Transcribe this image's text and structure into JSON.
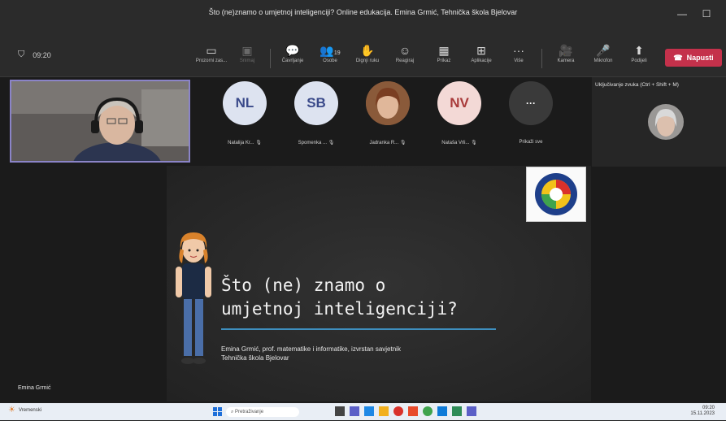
{
  "window": {
    "title": "Što (ne)znamo o umjetnoj inteligenciji? Online edukacija. Emina Grmić, Tehnička škola Bjelovar",
    "minimize": "—",
    "maximize": "☐"
  },
  "toolbar": {
    "timer": "09:20",
    "items": [
      {
        "icon": "share-screen-icon",
        "glyph": "▭",
        "label": "Prozorni zas..."
      },
      {
        "icon": "record-icon",
        "glyph": "▣",
        "label": "Snimaj"
      },
      {
        "icon": "chat-icon",
        "glyph": "💬",
        "label": "Čavrljanje"
      },
      {
        "icon": "people-icon",
        "glyph": "👥",
        "label": "Osobe",
        "badge": "19"
      },
      {
        "icon": "raise-hand-icon",
        "glyph": "✋",
        "label": "Dignji ruku"
      },
      {
        "icon": "reactions-icon",
        "glyph": "☺",
        "label": "Reagiraj"
      },
      {
        "icon": "view-icon",
        "glyph": "▦",
        "label": "Prikaz"
      },
      {
        "icon": "apps-icon",
        "glyph": "⊞",
        "label": "Aplikacije"
      },
      {
        "icon": "more-icon",
        "glyph": "···",
        "label": "Više"
      },
      {
        "icon": "camera-icon",
        "glyph": "🎥",
        "label": "Kamera"
      },
      {
        "icon": "mic-icon",
        "glyph": "🎤",
        "label": "Mikrofon"
      },
      {
        "icon": "share-icon",
        "glyph": "⬆",
        "label": "Podijeli"
      }
    ],
    "leave_label": "Napusti"
  },
  "participants": [
    {
      "initials": "NL",
      "name": "Natalija Kr...",
      "bg": "#dde3f0",
      "fg": "#3a4a8a"
    },
    {
      "initials": "SB",
      "name": "Spomenka ...",
      "bg": "#dde3f0",
      "fg": "#3a4a8a"
    },
    {
      "initials": "",
      "name": "Jadranka R...",
      "bg": "#8a5a3a",
      "fg": "#ffffff"
    },
    {
      "initials": "NV",
      "name": "Nataša Vrli...",
      "bg": "#f3d9d6",
      "fg": "#a83a3a"
    },
    {
      "initials": "···",
      "name": "Prikaži sve",
      "bg": "#3a3a3a",
      "fg": "#ffffff"
    }
  ],
  "right_panel": {
    "label": "Uključivanje zvuka (Ctrl + Shift + M)"
  },
  "slide": {
    "title_line1": "Što (ne) znamo o",
    "title_line2": "umjetnoj inteligenciji?",
    "subtitle_line1": "Emina Grmić, prof. matematike i informatike, izvrstan savjetnik",
    "subtitle_line2": "Tehnička škola Bjelovar",
    "logo_text": "TEHNIČKA ŠKOLA BJELOVAR"
  },
  "presenter_name": "Emina Grmić",
  "taskbar": {
    "search_placeholder": "Pretraživanje",
    "weather": "Vremenski",
    "time": "09:20",
    "date": "15.11.2023"
  },
  "colors": {
    "leave": "#c4314b",
    "accent": "#8b84c8",
    "underline": "#3e8fbf"
  }
}
